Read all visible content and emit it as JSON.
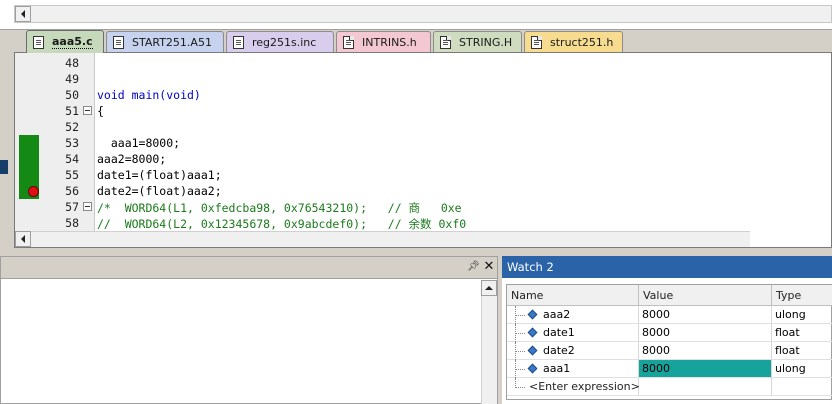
{
  "tabs": [
    {
      "label": "aaa5.c",
      "icon": "c-file-icon",
      "active": true,
      "color": "#c6d9ba"
    },
    {
      "label": "START251.A51",
      "icon": "asm-file-icon",
      "active": false,
      "color": "#c7d2ee"
    },
    {
      "label": "reg251s.inc",
      "icon": "inc-file-icon",
      "active": false,
      "color": "#d9cdee"
    },
    {
      "label": "INTRINS.h",
      "icon": "header-file-icon",
      "active": false,
      "color": "#f4c8d2"
    },
    {
      "label": "STRING.H",
      "icon": "header-file-icon",
      "active": false,
      "color": "#d0dcc0"
    },
    {
      "label": "struct251.h",
      "icon": "header-file-icon",
      "active": false,
      "color": "#f7dc90"
    }
  ],
  "editor": {
    "lines": [
      {
        "num": "48",
        "text": ""
      },
      {
        "num": "49",
        "text": ""
      },
      {
        "num": "50",
        "text": "void main(void)"
      },
      {
        "num": "51",
        "text": "{"
      },
      {
        "num": "52",
        "text": ""
      },
      {
        "num": "53",
        "text": "  aaa1=8000;"
      },
      {
        "num": "54",
        "text": "aaa2=8000;"
      },
      {
        "num": "55",
        "text": "date1=(float)aaa1;"
      },
      {
        "num": "56",
        "text": "date2=(float)aaa2;"
      },
      {
        "num": "57",
        "text": "/*  WORD64(L1, 0xfedcba98, 0x76543210);   // 商   0xe"
      },
      {
        "num": "58",
        "text": "//  WORD64(L2, 0x12345678, 0x9abcdef0);   // 余数 0xf0"
      }
    ]
  },
  "left_panel": {
    "pin_icon": "pin-icon",
    "close_icon": "close-icon"
  },
  "watch": {
    "title": "Watch 2",
    "columns": [
      "Name",
      "Value",
      "Type"
    ],
    "rows": [
      {
        "name": "aaa2",
        "value": "8000",
        "type": "ulong",
        "highlight": false
      },
      {
        "name": "date1",
        "value": "8000",
        "type": "float",
        "highlight": false
      },
      {
        "name": "date2",
        "value": "8000",
        "type": "float",
        "highlight": false
      },
      {
        "name": "aaa1",
        "value": "8000",
        "type": "ulong",
        "highlight": true
      }
    ],
    "enter_expression": "<Enter expression>",
    "highlight_color": "#16a39b"
  }
}
